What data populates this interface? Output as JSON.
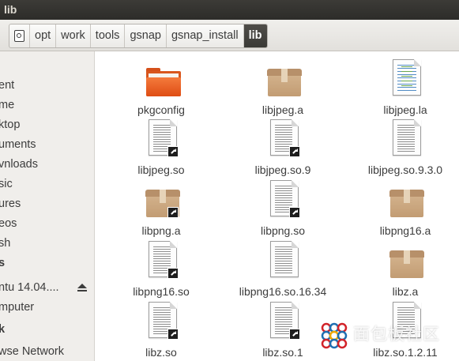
{
  "window": {
    "title": "lib"
  },
  "pathbar": {
    "crumbs": [
      "opt",
      "work",
      "tools",
      "gsnap",
      "gsnap_install"
    ],
    "current": "lib"
  },
  "sidebar": {
    "items": [
      {
        "label": "ent"
      },
      {
        "label": "me"
      },
      {
        "label": "ktop"
      },
      {
        "label": "uments"
      },
      {
        "label": "vnloads"
      },
      {
        "label": "sic"
      },
      {
        "label": "ures"
      },
      {
        "label": "eos"
      },
      {
        "label": "sh"
      },
      {
        "label": "s"
      },
      {
        "label": "ntu 14.04...."
      },
      {
        "label": "mputer"
      },
      {
        "label": "k"
      },
      {
        "label": "wse Network"
      }
    ]
  },
  "files": [
    {
      "name": "pkgconfig",
      "icon": "folder-icon"
    },
    {
      "name": "libjpeg.a",
      "icon": "package-icon"
    },
    {
      "name": "libjpeg.la",
      "icon": "text-file-icon"
    },
    {
      "name": "libjpeg.so",
      "icon": "text-file-icon",
      "symlink": true
    },
    {
      "name": "libjpeg.so.9",
      "icon": "text-file-icon",
      "symlink": true
    },
    {
      "name": "libjpeg.so.9.3.0",
      "icon": "text-file-icon"
    },
    {
      "name": "libpng.a",
      "icon": "package-icon",
      "symlink": true
    },
    {
      "name": "libpng.so",
      "icon": "text-file-icon",
      "symlink": true
    },
    {
      "name": "libpng16.a",
      "icon": "package-icon"
    },
    {
      "name": "libpng16.so",
      "icon": "text-file-icon",
      "symlink": true
    },
    {
      "name": "libpng16.so.16.34",
      "icon": "text-file-icon"
    },
    {
      "name": "libz.a",
      "icon": "package-icon"
    },
    {
      "name": "libz.so",
      "icon": "text-file-icon",
      "symlink": true
    },
    {
      "name": "libz.so.1",
      "icon": "text-file-icon",
      "symlink": true
    },
    {
      "name": "libz.so.1.2.11",
      "icon": "text-file-icon"
    }
  ],
  "watermark": {
    "text": "面包板社区"
  },
  "colors": {
    "titlebar": "#3c3b37",
    "folder": "#e0551c",
    "current_crumb": "#45433f"
  }
}
